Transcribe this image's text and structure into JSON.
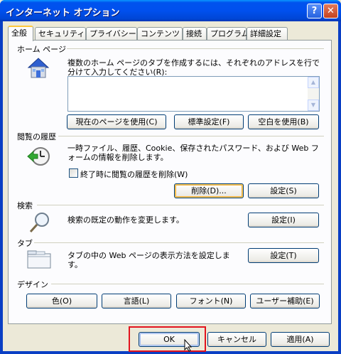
{
  "window": {
    "title": "インターネット オプション",
    "help_glyph": "?",
    "close_glyph": "✕"
  },
  "tabs": [
    {
      "label": "全般"
    },
    {
      "label": "セキュリティ"
    },
    {
      "label": "プライバシー"
    },
    {
      "label": "コンテンツ"
    },
    {
      "label": "接続"
    },
    {
      "label": "プログラム"
    },
    {
      "label": "詳細設定"
    }
  ],
  "home_page": {
    "heading": "ホーム ページ",
    "description": "複数のホーム ページのタブを作成するには、それぞれのアドレスを行で分けて入力してください(R):",
    "url_value": "",
    "use_current_label": "現在のページを使用(C)",
    "use_default_label": "標準設定(F)",
    "use_blank_label": "空白を使用(B)"
  },
  "history": {
    "heading": "閲覧の履歴",
    "description": "一時ファイル、履歴、Cookie、保存されたパスワード、および Web フォームの情報を削除します。",
    "checkbox_label": "終了時に閲覧の履歴を削除(W)",
    "checkbox_checked": false,
    "delete_label": "削除(D)...",
    "settings_label": "設定(S)"
  },
  "search": {
    "heading": "検索",
    "description": "検索の既定の動作を変更します。",
    "settings_label": "設定(I)"
  },
  "tabs_section": {
    "heading": "タブ",
    "description": "タブの中の Web ページの表示方法を設定します。",
    "settings_label": "設定(T)"
  },
  "design": {
    "heading": "デザイン",
    "colors_label": "色(O)",
    "languages_label": "言語(L)",
    "fonts_label": "フォント(N)",
    "accessibility_label": "ユーザー補助(E)"
  },
  "footer": {
    "ok_label": "OK",
    "cancel_label": "キャンセル",
    "apply_label": "適用(A)"
  },
  "colors": {
    "title_bar": "#0054e3",
    "accent_tab": "#ffc83c",
    "highlight_box": "#e2141e"
  }
}
